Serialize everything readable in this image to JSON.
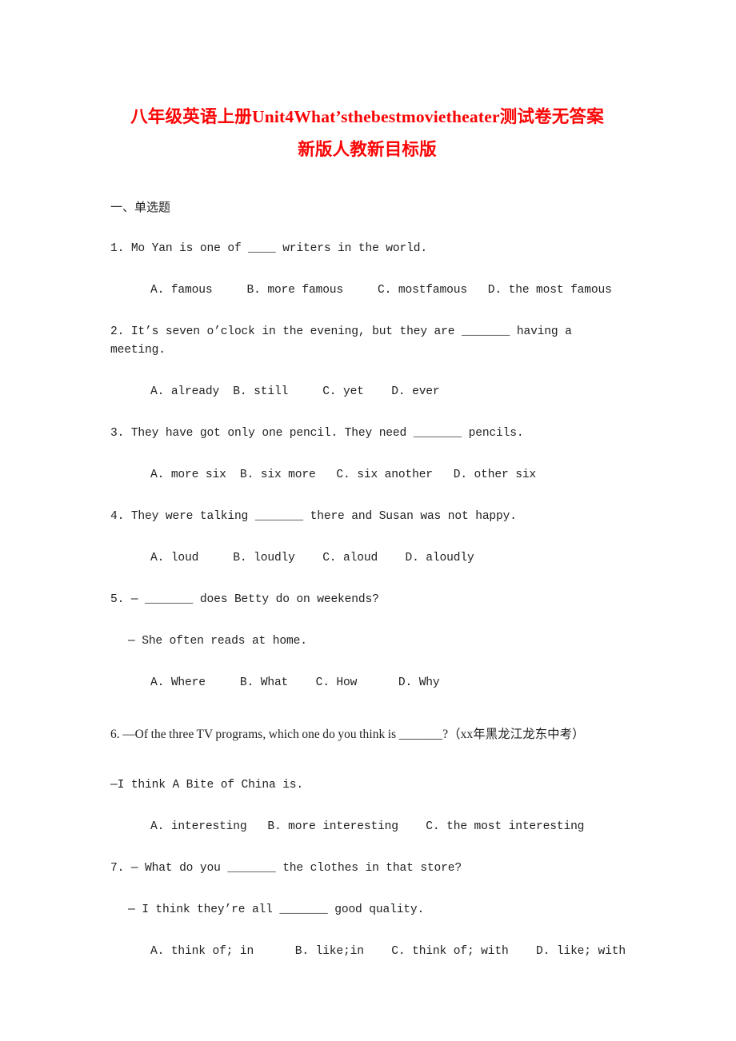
{
  "document": {
    "title_line_1": "八年级英语上册Unit4What’sthebestmovietheater测试卷无答案",
    "title_line_2": "新版人教新目标版",
    "title_color": "#fa0505",
    "body_color": "#1f1f1f",
    "background_color": "#ffffff"
  },
  "sections": [
    {
      "heading": "一、单选题",
      "questions": [
        {
          "stem": "1. Mo Yan is one of ____ writers in the world.",
          "reply": null,
          "options": "A. famous     B. more famous     C. mostfamous   D. the most famous"
        },
        {
          "stem": "2. It’s seven o’clock in the evening, but they are _______ having a meeting.",
          "reply": null,
          "options": "A. already  B. still     C. yet    D. ever"
        },
        {
          "stem": "3. They have got only one pencil. They need _______ pencils.",
          "reply": null,
          "options": "A. more six  B. six more   C. six another   D. other six"
        },
        {
          "stem": "4. They were talking _______ there and Susan was not happy.",
          "reply": null,
          "options": "A. loud     B. loudly    C. aloud    D. aloudly"
        },
        {
          "stem": "5. — _______ does Betty do on weekends?",
          "reply": "— She often reads at home.",
          "options": "A. Where     B. What    C. How      D. Why"
        },
        {
          "stem": "6. —Of the three TV programs, which one do you think is _______?（xx年黑龙江龙东中考）",
          "reply": "—I think A Bite of China is.",
          "options": "A. interesting   B. more interesting    C. the most interesting"
        },
        {
          "stem": "7. — What do you _______ the clothes in that store?",
          "reply": "— I think they’re all _______ good quality.",
          "options": "A. think of; in      B. like;in    C. think of; with    D. like; with"
        }
      ]
    }
  ]
}
